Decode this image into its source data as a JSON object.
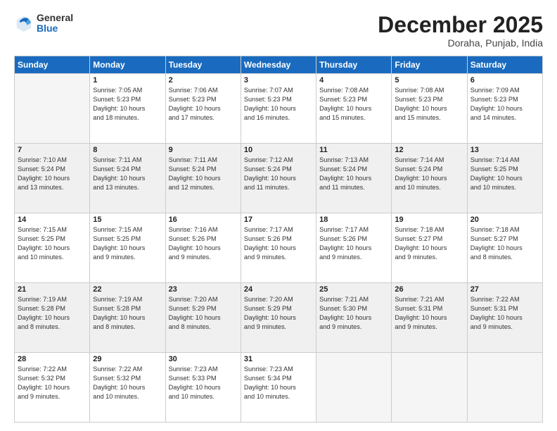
{
  "header": {
    "logo_general": "General",
    "logo_blue": "Blue",
    "month_title": "December 2025",
    "location": "Doraha, Punjab, India"
  },
  "days_of_week": [
    "Sunday",
    "Monday",
    "Tuesday",
    "Wednesday",
    "Thursday",
    "Friday",
    "Saturday"
  ],
  "weeks": [
    [
      {
        "num": "",
        "info": ""
      },
      {
        "num": "1",
        "info": "Sunrise: 7:05 AM\nSunset: 5:23 PM\nDaylight: 10 hours\nand 18 minutes."
      },
      {
        "num": "2",
        "info": "Sunrise: 7:06 AM\nSunset: 5:23 PM\nDaylight: 10 hours\nand 17 minutes."
      },
      {
        "num": "3",
        "info": "Sunrise: 7:07 AM\nSunset: 5:23 PM\nDaylight: 10 hours\nand 16 minutes."
      },
      {
        "num": "4",
        "info": "Sunrise: 7:08 AM\nSunset: 5:23 PM\nDaylight: 10 hours\nand 15 minutes."
      },
      {
        "num": "5",
        "info": "Sunrise: 7:08 AM\nSunset: 5:23 PM\nDaylight: 10 hours\nand 15 minutes."
      },
      {
        "num": "6",
        "info": "Sunrise: 7:09 AM\nSunset: 5:23 PM\nDaylight: 10 hours\nand 14 minutes."
      }
    ],
    [
      {
        "num": "7",
        "info": "Sunrise: 7:10 AM\nSunset: 5:24 PM\nDaylight: 10 hours\nand 13 minutes."
      },
      {
        "num": "8",
        "info": "Sunrise: 7:11 AM\nSunset: 5:24 PM\nDaylight: 10 hours\nand 13 minutes."
      },
      {
        "num": "9",
        "info": "Sunrise: 7:11 AM\nSunset: 5:24 PM\nDaylight: 10 hours\nand 12 minutes."
      },
      {
        "num": "10",
        "info": "Sunrise: 7:12 AM\nSunset: 5:24 PM\nDaylight: 10 hours\nand 11 minutes."
      },
      {
        "num": "11",
        "info": "Sunrise: 7:13 AM\nSunset: 5:24 PM\nDaylight: 10 hours\nand 11 minutes."
      },
      {
        "num": "12",
        "info": "Sunrise: 7:14 AM\nSunset: 5:24 PM\nDaylight: 10 hours\nand 10 minutes."
      },
      {
        "num": "13",
        "info": "Sunrise: 7:14 AM\nSunset: 5:25 PM\nDaylight: 10 hours\nand 10 minutes."
      }
    ],
    [
      {
        "num": "14",
        "info": "Sunrise: 7:15 AM\nSunset: 5:25 PM\nDaylight: 10 hours\nand 10 minutes."
      },
      {
        "num": "15",
        "info": "Sunrise: 7:15 AM\nSunset: 5:25 PM\nDaylight: 10 hours\nand 9 minutes."
      },
      {
        "num": "16",
        "info": "Sunrise: 7:16 AM\nSunset: 5:26 PM\nDaylight: 10 hours\nand 9 minutes."
      },
      {
        "num": "17",
        "info": "Sunrise: 7:17 AM\nSunset: 5:26 PM\nDaylight: 10 hours\nand 9 minutes."
      },
      {
        "num": "18",
        "info": "Sunrise: 7:17 AM\nSunset: 5:26 PM\nDaylight: 10 hours\nand 9 minutes."
      },
      {
        "num": "19",
        "info": "Sunrise: 7:18 AM\nSunset: 5:27 PM\nDaylight: 10 hours\nand 9 minutes."
      },
      {
        "num": "20",
        "info": "Sunrise: 7:18 AM\nSunset: 5:27 PM\nDaylight: 10 hours\nand 8 minutes."
      }
    ],
    [
      {
        "num": "21",
        "info": "Sunrise: 7:19 AM\nSunset: 5:28 PM\nDaylight: 10 hours\nand 8 minutes."
      },
      {
        "num": "22",
        "info": "Sunrise: 7:19 AM\nSunset: 5:28 PM\nDaylight: 10 hours\nand 8 minutes."
      },
      {
        "num": "23",
        "info": "Sunrise: 7:20 AM\nSunset: 5:29 PM\nDaylight: 10 hours\nand 8 minutes."
      },
      {
        "num": "24",
        "info": "Sunrise: 7:20 AM\nSunset: 5:29 PM\nDaylight: 10 hours\nand 9 minutes."
      },
      {
        "num": "25",
        "info": "Sunrise: 7:21 AM\nSunset: 5:30 PM\nDaylight: 10 hours\nand 9 minutes."
      },
      {
        "num": "26",
        "info": "Sunrise: 7:21 AM\nSunset: 5:31 PM\nDaylight: 10 hours\nand 9 minutes."
      },
      {
        "num": "27",
        "info": "Sunrise: 7:22 AM\nSunset: 5:31 PM\nDaylight: 10 hours\nand 9 minutes."
      }
    ],
    [
      {
        "num": "28",
        "info": "Sunrise: 7:22 AM\nSunset: 5:32 PM\nDaylight: 10 hours\nand 9 minutes."
      },
      {
        "num": "29",
        "info": "Sunrise: 7:22 AM\nSunset: 5:32 PM\nDaylight: 10 hours\nand 10 minutes."
      },
      {
        "num": "30",
        "info": "Sunrise: 7:23 AM\nSunset: 5:33 PM\nDaylight: 10 hours\nand 10 minutes."
      },
      {
        "num": "31",
        "info": "Sunrise: 7:23 AM\nSunset: 5:34 PM\nDaylight: 10 hours\nand 10 minutes."
      },
      {
        "num": "",
        "info": ""
      },
      {
        "num": "",
        "info": ""
      },
      {
        "num": "",
        "info": ""
      }
    ]
  ]
}
